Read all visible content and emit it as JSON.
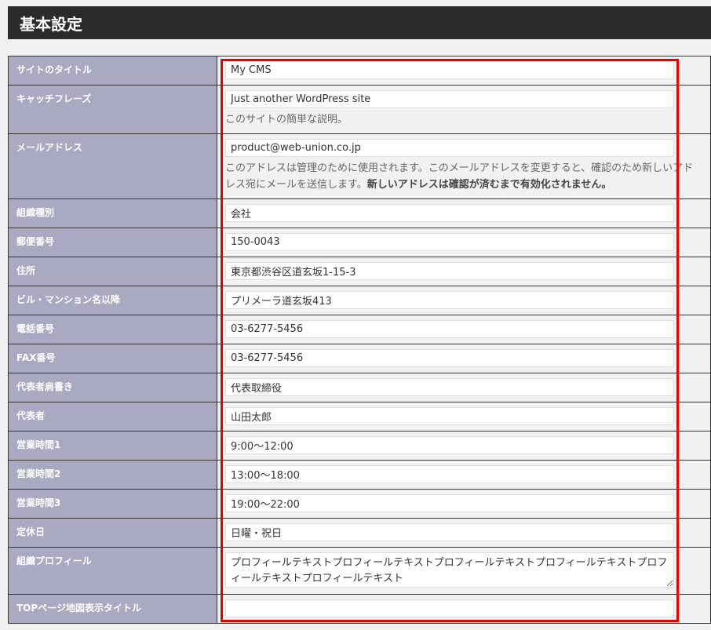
{
  "section": {
    "title": "基本設定"
  },
  "fields": {
    "site_title": {
      "label": "サイトのタイトル",
      "value": "My CMS"
    },
    "tagline": {
      "label": "キャッチフレーズ",
      "value": "Just another WordPress site",
      "description": "このサイトの簡単な説明。"
    },
    "email": {
      "label": "メールアドレス",
      "value": "product@web-union.co.jp",
      "description": "このアドレスは管理のために使用されます。このメールアドレスを変更すると、確認のため新しいアドレス宛にメールを送信します。",
      "description_strong": "新しいアドレスは確認が済むまで有効化されません。"
    },
    "org_type": {
      "label": "組織種別",
      "value": "会社"
    },
    "postal_code": {
      "label": "郵便番号",
      "value": "150-0043"
    },
    "address": {
      "label": "住所",
      "value": "東京都渋谷区道玄坂1-15-3"
    },
    "building": {
      "label": "ビル・マンション名以降",
      "value": "プリメーラ道玄坂413"
    },
    "phone": {
      "label": "電話番号",
      "value": "03-6277-5456"
    },
    "fax": {
      "label": "FAX番号",
      "value": "03-6277-5456"
    },
    "rep_title": {
      "label": "代表者肩書き",
      "value": "代表取締役"
    },
    "representative": {
      "label": "代表者",
      "value": "山田太郎"
    },
    "hours1": {
      "label": "営業時間1",
      "value": "9:00～12:00"
    },
    "hours2": {
      "label": "営業時間2",
      "value": "13:00～18:00"
    },
    "hours3": {
      "label": "営業時間3",
      "value": "19:00～22:00"
    },
    "holiday": {
      "label": "定休日",
      "value": "日曜・祝日"
    },
    "profile": {
      "label": "組織プロフィール",
      "value": "プロフィールテキストプロフィールテキストプロフィールテキストプロフィールテキストプロフィールテキストプロフィールテキスト"
    },
    "map_title": {
      "label": "TOPページ地図表示タイトル",
      "value": ""
    }
  },
  "colors": {
    "header_bg": "#2b2b2b",
    "label_bg": "#a9a9c2",
    "highlight": "#e60000"
  }
}
